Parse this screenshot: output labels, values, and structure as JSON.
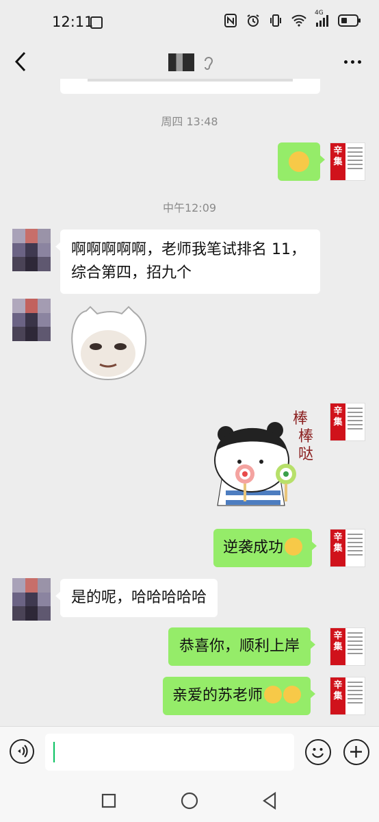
{
  "status_bar": {
    "time": "12:11",
    "network_label": "4G"
  },
  "header": {
    "title_blurred": true
  },
  "messages": [
    {
      "type": "timestamp",
      "text": "周四 13:48"
    },
    {
      "type": "timestamp",
      "text": "中午12:09"
    },
    {
      "side": "left",
      "text_line1": "啊啊啊啊啊，老师我笔试排名 11，",
      "text_line2": "综合第四，招九个"
    },
    {
      "side": "left",
      "sticker": "round-face-sticker"
    },
    {
      "side": "right",
      "sticker": "bangbangda-sticker",
      "sticker_text": [
        "棒",
        "棒",
        "哒"
      ]
    },
    {
      "side": "right",
      "text": "逆袭成功"
    },
    {
      "side": "left",
      "text": "是的呢，哈哈哈哈哈"
    },
    {
      "side": "right",
      "text": "恭喜你，顺利上岸"
    },
    {
      "side": "right",
      "text": "亲爱的苏老师"
    }
  ],
  "self_avatar": {
    "big_chars": [
      "辛",
      "集"
    ]
  },
  "colors": {
    "bubble_green": "#95ec69",
    "background": "#ededed",
    "bubble_white": "#ffffff",
    "accent_red": "#d0121b"
  }
}
